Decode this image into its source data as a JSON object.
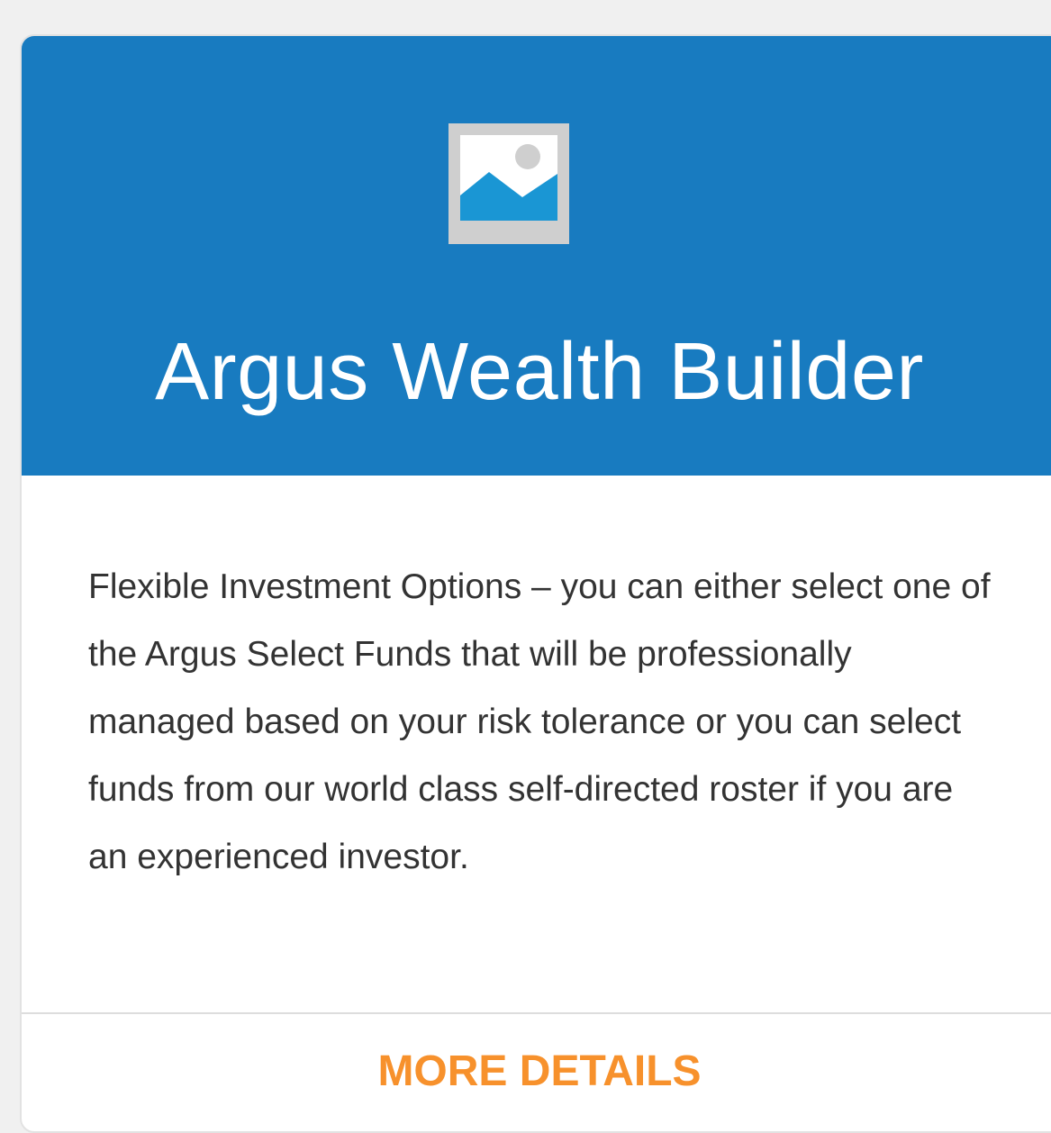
{
  "card": {
    "title": "Argus Wealth Builder",
    "image_icon": "image-placeholder-icon",
    "description": "Flexible Investment Options – you can either select one of the Argus Select Funds that will be professionally managed based on your risk tolerance or you can select funds from our world class self-directed roster if you are an experienced investor.",
    "link_label": "MORE DETAILS"
  },
  "colors": {
    "header_background": "#187bc0",
    "title_text": "#ffffff",
    "body_text": "#333333",
    "link_text": "#f7912c",
    "page_background": "#f0f0f0"
  }
}
